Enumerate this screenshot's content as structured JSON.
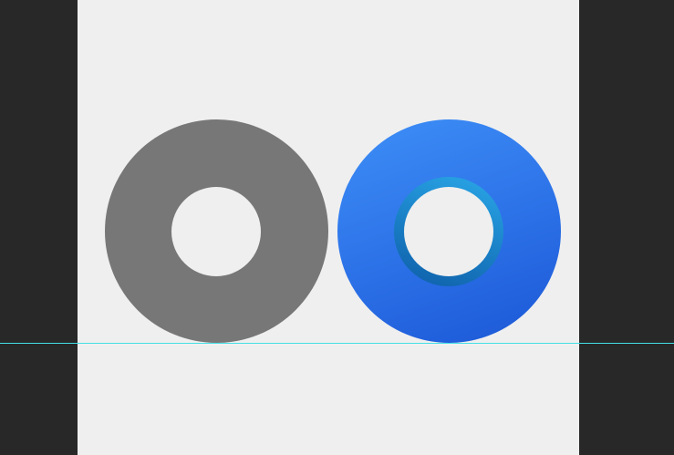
{
  "workspace": {
    "background_color": "#282828",
    "canvas_color": "#efefef"
  },
  "shapes": [
    {
      "name": "gray-ring",
      "color": "#777777"
    },
    {
      "name": "blue-ring",
      "gradient": [
        "#3d8ff7",
        "#1b57d6"
      ],
      "inner_ring_color": "#1b82c8"
    }
  ],
  "guides": {
    "horizontal_guide_color": "#43e0e6"
  }
}
